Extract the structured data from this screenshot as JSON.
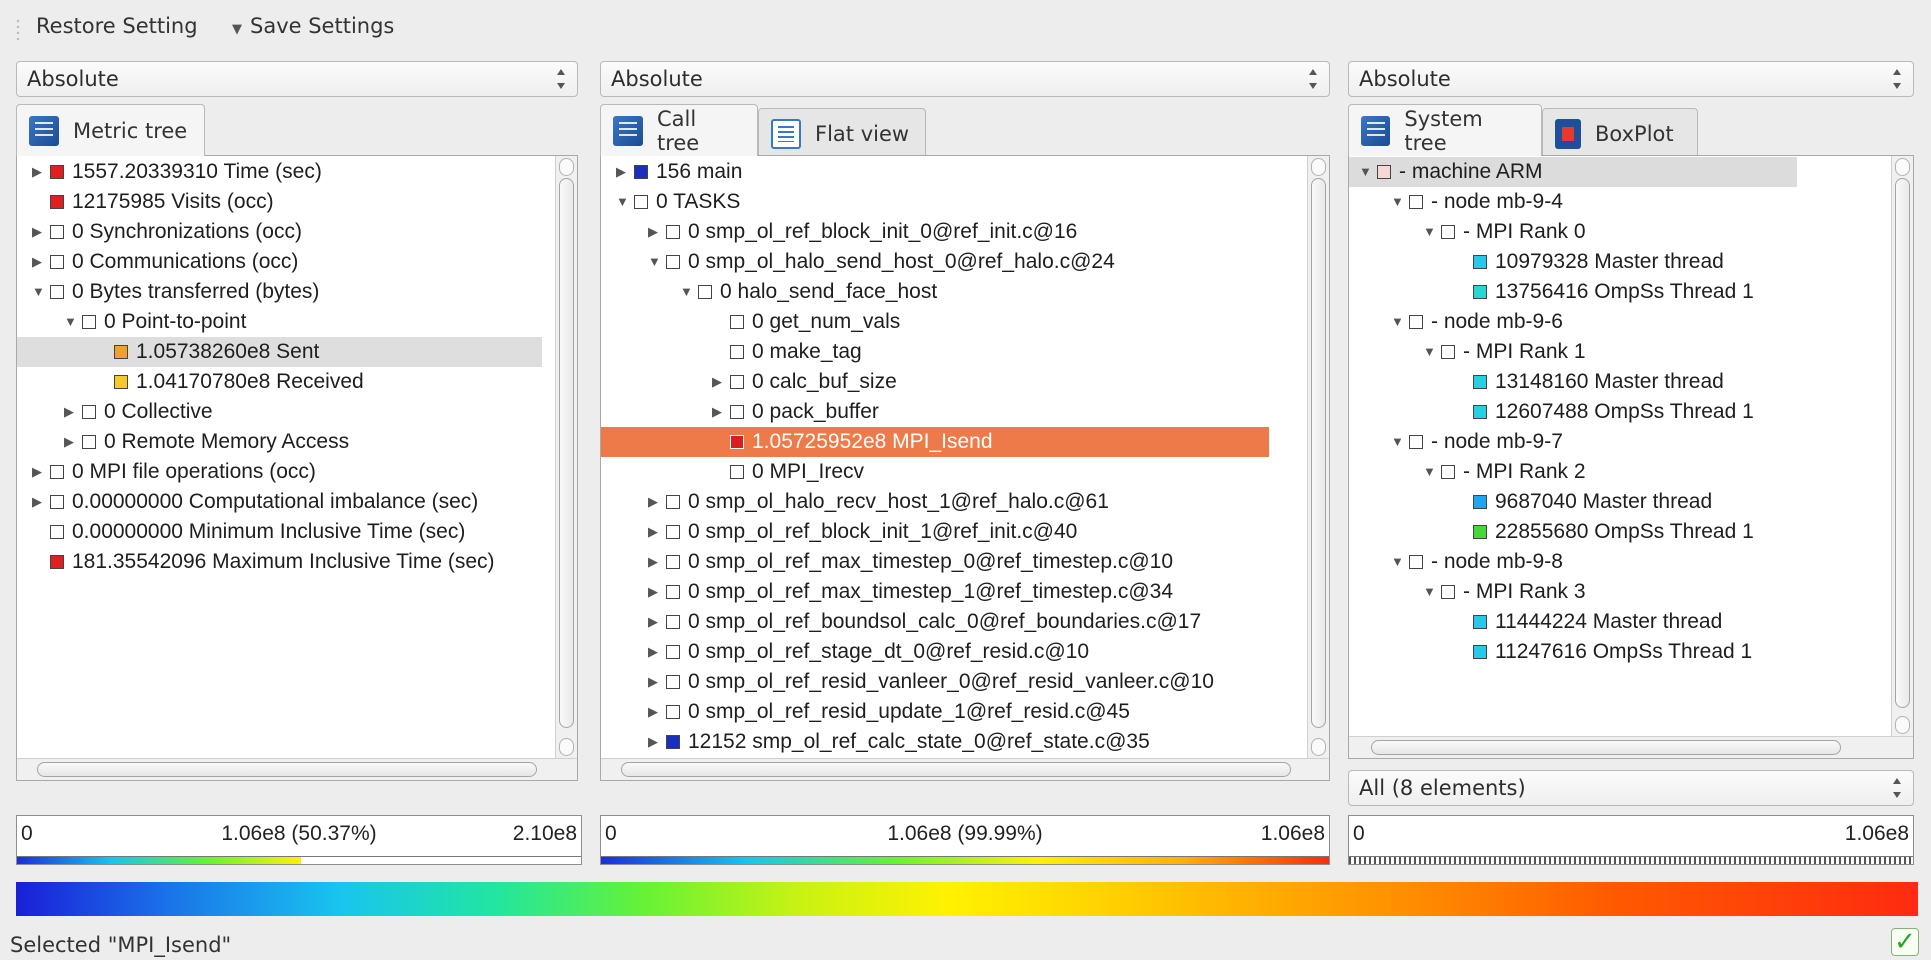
{
  "toolbar": {
    "restore_label": "Restore Setting",
    "save_label": "Save Settings"
  },
  "panels": {
    "metric": {
      "mode": "Absolute",
      "tab_label": "Metric tree",
      "rows": [
        {
          "arrow": "▶",
          "color": "#e02020",
          "text": "1557.20339310 Time (sec)"
        },
        {
          "arrow": "",
          "color": "#e02020",
          "text": "12175985 Visits (occ)"
        },
        {
          "arrow": "▶",
          "color": "#ffffff",
          "text": "0 Synchronizations (occ)"
        },
        {
          "arrow": "▶",
          "color": "#ffffff",
          "text": "0 Communications (occ)"
        },
        {
          "arrow": "▼",
          "color": "#ffffff",
          "text": "0 Bytes transferred (bytes)"
        },
        {
          "arrow": "▼",
          "color": "#ffffff",
          "text": "0 Point-to-point"
        },
        {
          "arrow": "",
          "color": "#f0a030",
          "text": "1.05738260e8 Sent"
        },
        {
          "arrow": "",
          "color": "#f6c92a",
          "text": "1.04170780e8 Received"
        },
        {
          "arrow": "▶",
          "color": "#ffffff",
          "text": "0 Collective"
        },
        {
          "arrow": "▶",
          "color": "#ffffff",
          "text": "0 Remote Memory Access"
        },
        {
          "arrow": "▶",
          "color": "#ffffff",
          "text": "0 MPI file operations (occ)"
        },
        {
          "arrow": "▶",
          "color": "#ffffff",
          "text": "0.00000000 Computational imbalance (sec)"
        },
        {
          "arrow": "",
          "color": "#ffffff",
          "text": "0.00000000 Minimum Inclusive Time (sec)"
        },
        {
          "arrow": "",
          "color": "#e02020",
          "text": "181.35542096 Maximum Inclusive Time (sec)"
        }
      ],
      "scale": {
        "min": "0",
        "mid": "1.06e8 (50.37%)",
        "max": "2.10e8",
        "fill_fraction": 0.5037
      }
    },
    "call": {
      "mode": "Absolute",
      "tab_call": "Call tree",
      "tab_flat": "Flat view",
      "rows": [
        {
          "arrow": "▶",
          "color": "#1a2fc0",
          "text": "156 main"
        },
        {
          "arrow": "▼",
          "color": "#ffffff",
          "text": "0 TASKS"
        },
        {
          "arrow": "▶",
          "color": "#ffffff",
          "text": "0 smp_ol_ref_block_init_0@ref_init.c@16"
        },
        {
          "arrow": "▼",
          "color": "#ffffff",
          "text": "0 smp_ol_halo_send_host_0@ref_halo.c@24"
        },
        {
          "arrow": "▼",
          "color": "#ffffff",
          "text": "0 halo_send_face_host"
        },
        {
          "arrow": "",
          "color": "#ffffff",
          "text": "0 get_num_vals"
        },
        {
          "arrow": "",
          "color": "#ffffff",
          "text": "0 make_tag"
        },
        {
          "arrow": "▶",
          "color": "#ffffff",
          "text": "0 calc_buf_size"
        },
        {
          "arrow": "▶",
          "color": "#ffffff",
          "text": "0 pack_buffer"
        },
        {
          "arrow": "",
          "color": "#d81f1f",
          "text": "1.05725952e8 MPI_Isend"
        },
        {
          "arrow": "",
          "color": "#ffffff",
          "text": "0 MPI_Irecv"
        },
        {
          "arrow": "▶",
          "color": "#ffffff",
          "text": "0 smp_ol_halo_recv_host_1@ref_halo.c@61"
        },
        {
          "arrow": "▶",
          "color": "#ffffff",
          "text": "0 smp_ol_ref_block_init_1@ref_init.c@40"
        },
        {
          "arrow": "▶",
          "color": "#ffffff",
          "text": "0 smp_ol_ref_max_timestep_0@ref_timestep.c@10"
        },
        {
          "arrow": "▶",
          "color": "#ffffff",
          "text": "0 smp_ol_ref_max_timestep_1@ref_timestep.c@34"
        },
        {
          "arrow": "▶",
          "color": "#ffffff",
          "text": "0 smp_ol_ref_boundsol_calc_0@ref_boundaries.c@17"
        },
        {
          "arrow": "▶",
          "color": "#ffffff",
          "text": "0 smp_ol_ref_stage_dt_0@ref_resid.c@10"
        },
        {
          "arrow": "▶",
          "color": "#ffffff",
          "text": "0 smp_ol_ref_resid_vanleer_0@ref_resid_vanleer.c@10"
        },
        {
          "arrow": "▶",
          "color": "#ffffff",
          "text": "0 smp_ol_ref_resid_update_1@ref_resid.c@45"
        },
        {
          "arrow": "▶",
          "color": "#1a2fc0",
          "text": "12152 smp_ol_ref_calc_state_0@ref_state.c@35"
        }
      ],
      "scale": {
        "min": "0",
        "mid": "1.06e8 (99.99%)",
        "max": "1.06e8",
        "fill_fraction": 0.9999
      }
    },
    "system": {
      "mode": "Absolute",
      "tab_system": "System tree",
      "tab_box": "BoxPlot",
      "rows": [
        {
          "arrow": "▼",
          "color": "#f7d6d6",
          "text": "- machine ARM"
        },
        {
          "arrow": "▼",
          "color": "#ffffff",
          "text": "- node mb-9-4"
        },
        {
          "arrow": "▼",
          "color": "#ffffff",
          "text": "- MPI Rank 0"
        },
        {
          "arrow": "",
          "color": "#27c8e8",
          "text": "10979328 Master thread"
        },
        {
          "arrow": "",
          "color": "#27d8d0",
          "text": "13756416 OmpSs  Thread 1"
        },
        {
          "arrow": "▼",
          "color": "#ffffff",
          "text": "- node mb-9-6"
        },
        {
          "arrow": "▼",
          "color": "#ffffff",
          "text": "- MPI Rank 1"
        },
        {
          "arrow": "",
          "color": "#27d0e0",
          "text": "13148160 Master thread"
        },
        {
          "arrow": "",
          "color": "#27d0e0",
          "text": "12607488 OmpSs  Thread 1"
        },
        {
          "arrow": "▼",
          "color": "#ffffff",
          "text": "- node mb-9-7"
        },
        {
          "arrow": "▼",
          "color": "#ffffff",
          "text": "- MPI Rank 2"
        },
        {
          "arrow": "",
          "color": "#1fa6f0",
          "text": "9687040 Master thread"
        },
        {
          "arrow": "",
          "color": "#44d83a",
          "text": "22855680 OmpSs  Thread 1"
        },
        {
          "arrow": "▼",
          "color": "#ffffff",
          "text": "- node mb-9-8"
        },
        {
          "arrow": "▼",
          "color": "#ffffff",
          "text": "- MPI Rank 3"
        },
        {
          "arrow": "",
          "color": "#27c8e8",
          "text": "11444224 Master thread"
        },
        {
          "arrow": "",
          "color": "#27c8e8",
          "text": "11247616 OmpSs  Thread 1"
        }
      ],
      "filter": "All (8 elements)",
      "scale": {
        "min": "0",
        "mid": "",
        "max": "1.06e8"
      }
    }
  },
  "status": {
    "text": "Selected \"MPI_Isend\"",
    "ok_icon": "checkmark-icon"
  },
  "colors": {
    "selection": "#ee7a49",
    "hover": "#dedede"
  }
}
